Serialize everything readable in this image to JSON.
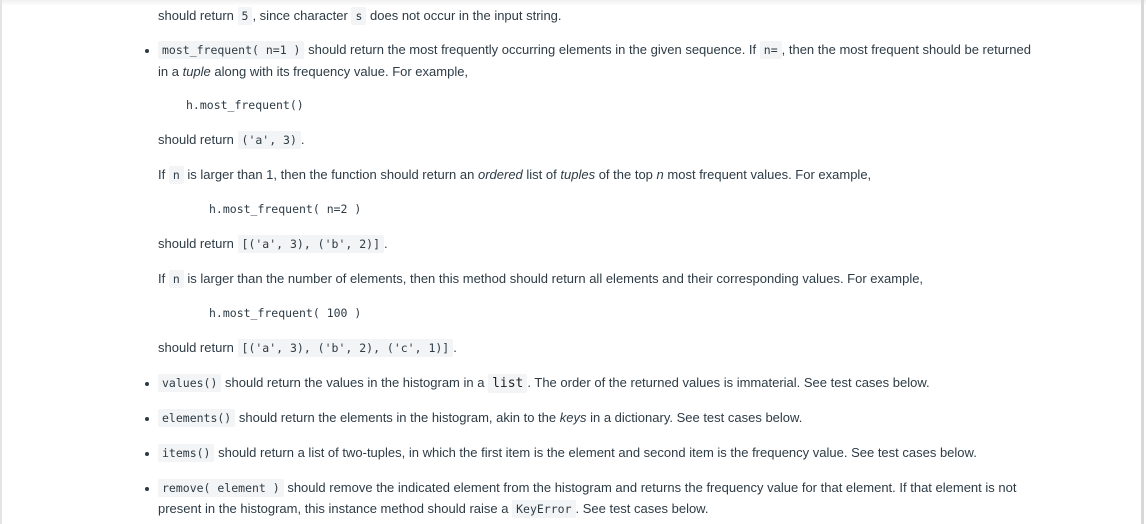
{
  "intro": {
    "prefix": "should return",
    "code1": "5",
    "mid": ", since character",
    "code2": "s",
    "suffix": "does not occur in the input string."
  },
  "most_frequent": {
    "signature": "most_frequent( n=1 )",
    "text1": "should return the most frequently occurring elements in the given sequence. If",
    "code_n_eq": "n=",
    "text2": ", then the most frequent should be returned",
    "line2_prefix": "in a",
    "line2_em": "tuple",
    "line2_suffix": "along with its frequency value. For example,",
    "example1_call": "h.most_frequent()",
    "example1_prefix": "should return",
    "example1_result": "('a', 3)",
    "example1_suffix": ".",
    "n_gt_1_prefix": "If",
    "n_code": "n",
    "n_gt_1_text1": "is larger than 1, then the function should return an",
    "n_gt_1_em1": "ordered",
    "n_gt_1_text2": "list of",
    "n_gt_1_em2": "tuples",
    "n_gt_1_text3": "of the top",
    "n_gt_1_em3": "n",
    "n_gt_1_text4": "most frequent values. For example,",
    "example2_call": "h.most_frequent( n=2 )",
    "example2_prefix": "should return",
    "example2_result": "[('a', 3), ('b', 2)]",
    "example2_suffix": ".",
    "n_large_prefix": "If",
    "n_large_text": "is larger than the number of elements, then this method should return all elements and their corresponding values. For example,",
    "example3_call": "h.most_frequent( 100 )",
    "example3_prefix": "should return",
    "example3_result": "[('a', 3), ('b', 2), ('c', 1)]",
    "example3_suffix": "."
  },
  "values": {
    "signature": "values()",
    "text1": "should return the values in the histogram in a",
    "code_list": "list",
    "text2": ". The order of the returned values is immaterial. See test cases below."
  },
  "elements": {
    "signature": "elements()",
    "text1": "should return the elements in the histogram, akin to the",
    "em": "keys",
    "text2": "in a dictionary. See test cases below."
  },
  "items": {
    "signature": "items()",
    "text": "should return a list of two-tuples, in which the first item is the element and second item is the frequency value. See test cases below."
  },
  "remove": {
    "signature": "remove( element )",
    "text1": "should remove the indicated element from the histogram and returns the frequency value for that element. If that element is not",
    "line2_prefix": "present in the histogram, this instance method should raise a",
    "code_error": "KeyError",
    "line2_suffix": ". See test cases below."
  }
}
